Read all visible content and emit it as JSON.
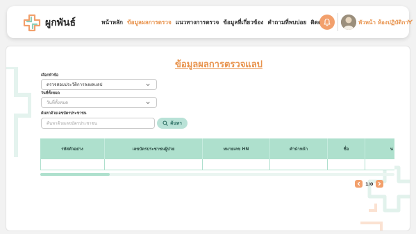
{
  "header": {
    "brand": "ผูกพันธ์",
    "nav": [
      {
        "label": "หน้าหลัก",
        "active": false
      },
      {
        "label": "ข้อมูลผลการตรวจ",
        "active": true
      },
      {
        "label": "แนวทางการตรวจ",
        "active": false
      },
      {
        "label": "ข้อมูลที่เกี่ยวข้อง",
        "active": false
      },
      {
        "label": "คำถามที่พบบ่อย",
        "active": false
      },
      {
        "label": "ติดต่อเรา",
        "active": false
      }
    ],
    "user_name": "หัวหน้า ห้องปฏิบัติการ"
  },
  "page": {
    "title": "ข้อมูลผลการตรวจแลป"
  },
  "filters": {
    "topic_label": "เลือกหัวข้อ",
    "topic_value": "ตรวจสอบประวัติการลงผลแลป",
    "date_label": "วันที่ทั้งหมด",
    "date_placeholder": "วันที่ทั้งหมด",
    "search_label": "ค้นหาด้วยเลขบัตรประชาชน",
    "search_placeholder": "ค้นหาด้วยเลขบัตรประชาชน",
    "search_button": "ค้นหา"
  },
  "table": {
    "columns": [
      "รหัสตัวอย่าง",
      "เลขบัตรประชาชนผู้ป่วย",
      "หมายเลข HN",
      "คำนำหน้า",
      "ชื่อ",
      "น"
    ]
  },
  "pagination": {
    "text": "1/0"
  },
  "colors": {
    "accent": "#e8934d",
    "mint": "#aee0cd",
    "bell": "#f2a06c"
  }
}
